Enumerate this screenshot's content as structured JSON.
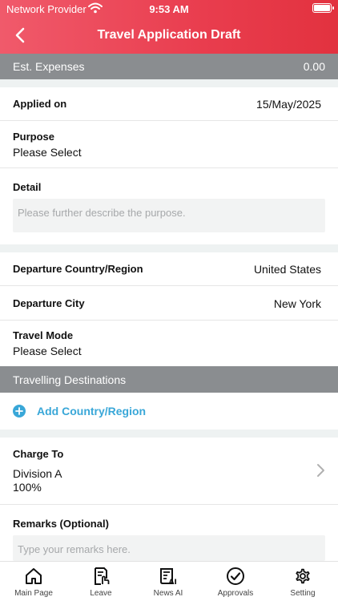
{
  "status_bar": {
    "carrier": "Network Provider",
    "time": "9:53 AM"
  },
  "header": {
    "title": "Travel Application Draft",
    "back_icon": "chevron-left-icon",
    "background": "#e93d4e"
  },
  "expenses": {
    "label": "Est. Expenses",
    "value": "0.00"
  },
  "applied_on": {
    "label": "Applied on",
    "value": "15/May/2025"
  },
  "purpose": {
    "label": "Purpose",
    "value": "Please Select"
  },
  "detail": {
    "label": "Detail",
    "placeholder": "Please further describe the purpose."
  },
  "departure_country": {
    "label": "Departure Country/Region",
    "value": "United States"
  },
  "departure_city": {
    "label": "Departure City",
    "value": "New York"
  },
  "travel_mode": {
    "label": "Travel Mode",
    "value": "Please Select"
  },
  "destinations": {
    "header": "Travelling Destinations",
    "add_label": "Add Country/Region",
    "accent": "#39a7d8"
  },
  "charge_to": {
    "label": "Charge To",
    "division": "Division A",
    "percent": "100%"
  },
  "remarks": {
    "label": "Remarks (Optional)",
    "placeholder": "Type your remarks here."
  },
  "tabs": [
    {
      "label": "Main Page",
      "icon": "home-icon"
    },
    {
      "label": "Leave",
      "icon": "leave-document-icon"
    },
    {
      "label": "News AI",
      "icon": "news-ai-icon"
    },
    {
      "label": "Approvals",
      "icon": "checkmark-circle-icon"
    },
    {
      "label": "Setting",
      "icon": "gear-icon"
    }
  ]
}
